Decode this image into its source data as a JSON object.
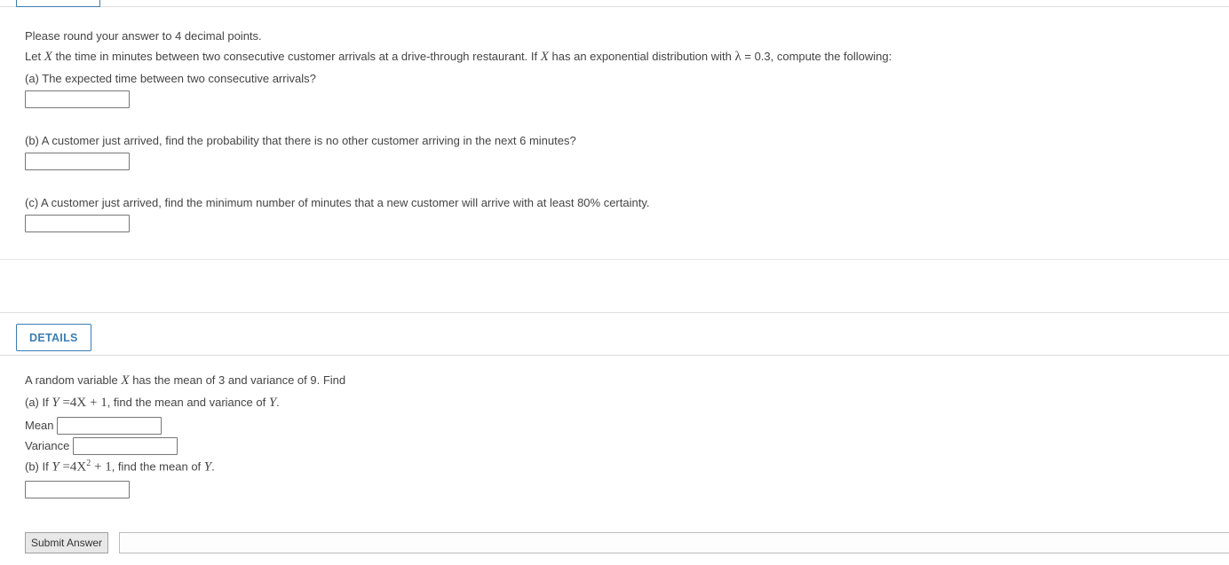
{
  "q1": {
    "instruction": "Please round your answer to 4 decimal points.",
    "stem_pre": "Let ",
    "stem_mid": " the time in minutes between two consecutive customer arrivals at a drive-through restaurant. If ",
    "stem_post": " has an exponential distribution with ",
    "lambda_eq": " = 0.3, compute the following:",
    "a": "(a) The expected time between two consecutive arrivals?",
    "b": "(b) A customer just arrived, find the probability that there is no other customer arriving in the next 6 minutes?",
    "c": "(c) A customer just arrived, find the minimum number of minutes that a new customer will arrive with at least 80% certainty."
  },
  "details_label": "DETAILS",
  "q2": {
    "stem_pre": "A random variable ",
    "stem_post": " has the mean of 3 and variance of 9. Find",
    "a_pre": "(a) If ",
    "a_eq_lhs": "Y",
    "a_eq_rhs": " =4X + 1",
    "a_post": ", find the mean and variance of ",
    "a_tail": ".",
    "mean_label": "Mean",
    "variance_label": "Variance",
    "b_pre": "(b) If ",
    "b_eq_lhs": "Y",
    "b_eq_rhs_a": " =4X",
    "b_eq_sup": "2",
    "b_eq_rhs_b": " + 1",
    "b_post": ", find the mean of ",
    "b_tail": "."
  },
  "submit_label": "Submit Answer",
  "vars": {
    "X": "X",
    "Y": "Y",
    "lambda": "λ"
  }
}
